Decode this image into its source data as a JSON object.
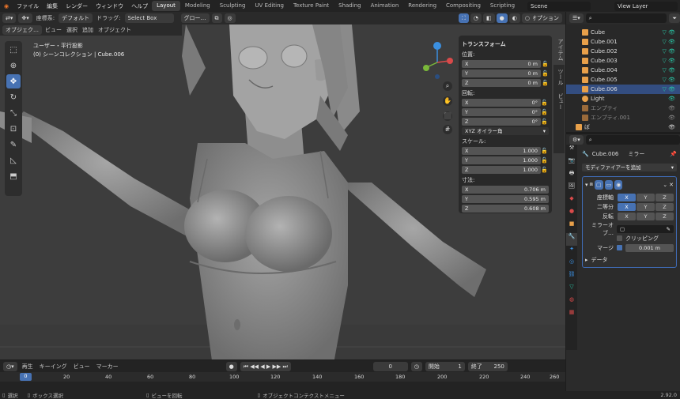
{
  "menu": {
    "items": [
      "ファイル",
      "編集",
      "レンダー",
      "ウィンドウ",
      "ヘルプ"
    ]
  },
  "workspaces": [
    "Layout",
    "Modeling",
    "Sculpting",
    "UV Editing",
    "Texture Paint",
    "Shading",
    "Animation",
    "Rendering",
    "Compositing",
    "Scripting"
  ],
  "scene": "Scene",
  "view_layer": "View Layer",
  "header": {
    "coord_label": "座標系:",
    "coord_value": "デフォルト",
    "drag_label": "ドラッグ:",
    "drag_value": "Select Box",
    "orient": "グロー…",
    "options": "オプション"
  },
  "header2": {
    "object_mode": "オブジェク…",
    "items": [
      "ビュー",
      "選択",
      "追加",
      "オブジェクト"
    ]
  },
  "viewport": {
    "view_name": "ユーザー・平行投影",
    "collection": "(0) シーンコレクション | Cube.006"
  },
  "tools": [
    "select",
    "cursor",
    "move",
    "rotate",
    "scale",
    "transform",
    "annotate",
    "measure",
    "add-cube"
  ],
  "ntabs": [
    "アイテム",
    "ツール",
    "ビュー"
  ],
  "transform": {
    "title": "トランスフォーム",
    "location_label": "位置:",
    "rotation_label": "回転:",
    "mode": "XYZ オイラー角",
    "scale_label": "スケール:",
    "dims_label": "寸法:",
    "location": [
      {
        "axis": "X",
        "value": "0 m"
      },
      {
        "axis": "Y",
        "value": "0 m"
      },
      {
        "axis": "Z",
        "value": "0 m"
      }
    ],
    "rotation": [
      {
        "axis": "X",
        "value": "0°"
      },
      {
        "axis": "Y",
        "value": "0°"
      },
      {
        "axis": "Z",
        "value": "0°"
      }
    ],
    "scale": [
      {
        "axis": "X",
        "value": "1.000"
      },
      {
        "axis": "Y",
        "value": "1.000"
      },
      {
        "axis": "Z",
        "value": "1.000"
      }
    ],
    "dims": [
      {
        "axis": "X",
        "value": "0.706 m"
      },
      {
        "axis": "Y",
        "value": "0.595 m"
      },
      {
        "axis": "Z",
        "value": "0.608 m"
      }
    ]
  },
  "outliner": {
    "items": [
      {
        "name": "Cube",
        "color": "#e8a04a"
      },
      {
        "name": "Cube.001",
        "color": "#e8a04a"
      },
      {
        "name": "Cube.002",
        "color": "#e8a04a"
      },
      {
        "name": "Cube.003",
        "color": "#e8a04a"
      },
      {
        "name": "Cube.004",
        "color": "#e8a04a"
      },
      {
        "name": "Cube.005",
        "color": "#e8a04a"
      },
      {
        "name": "Cube.006",
        "color": "#e8a04a"
      },
      {
        "name": "Light",
        "color": "#e8a04a"
      },
      {
        "name": "エンプティ",
        "color": "#9a6a3a"
      },
      {
        "name": "エンプティ.001",
        "color": "#9a6a3a"
      },
      {
        "name": "ぼ",
        "color": "#e8a04a"
      }
    ]
  },
  "props": {
    "object": "Cube.006",
    "modifier_tab": "ミラー",
    "add_modifier": "モディファイアーを追加",
    "axis_label": "座標軸",
    "bisect_label": "二等分",
    "flip_label": "反転",
    "mirror_obj_label": "ミラーオブ…",
    "clipping_label": "クリッピング",
    "merge_label": "マージ",
    "merge_value": "0.001 m",
    "data_label": "データ",
    "xyz": [
      "X",
      "Y",
      "Z"
    ]
  },
  "timeline": {
    "playback": "再生",
    "keying": "キーイング",
    "view": "ビュー",
    "marker": "マーカー",
    "current": "0",
    "start_label": "開始",
    "start": "1",
    "end_label": "終了",
    "end": "250",
    "ticks": [
      "0",
      "20",
      "40",
      "60",
      "80",
      "100",
      "120",
      "140",
      "160",
      "180",
      "200",
      "220",
      "240",
      "260"
    ]
  },
  "status": {
    "select": "選択",
    "box_select": "ボックス選択",
    "rotate_view": "ビューを回転",
    "context_menu": "オブジェクトコンテクストメニュー",
    "version": "2.92.0"
  }
}
